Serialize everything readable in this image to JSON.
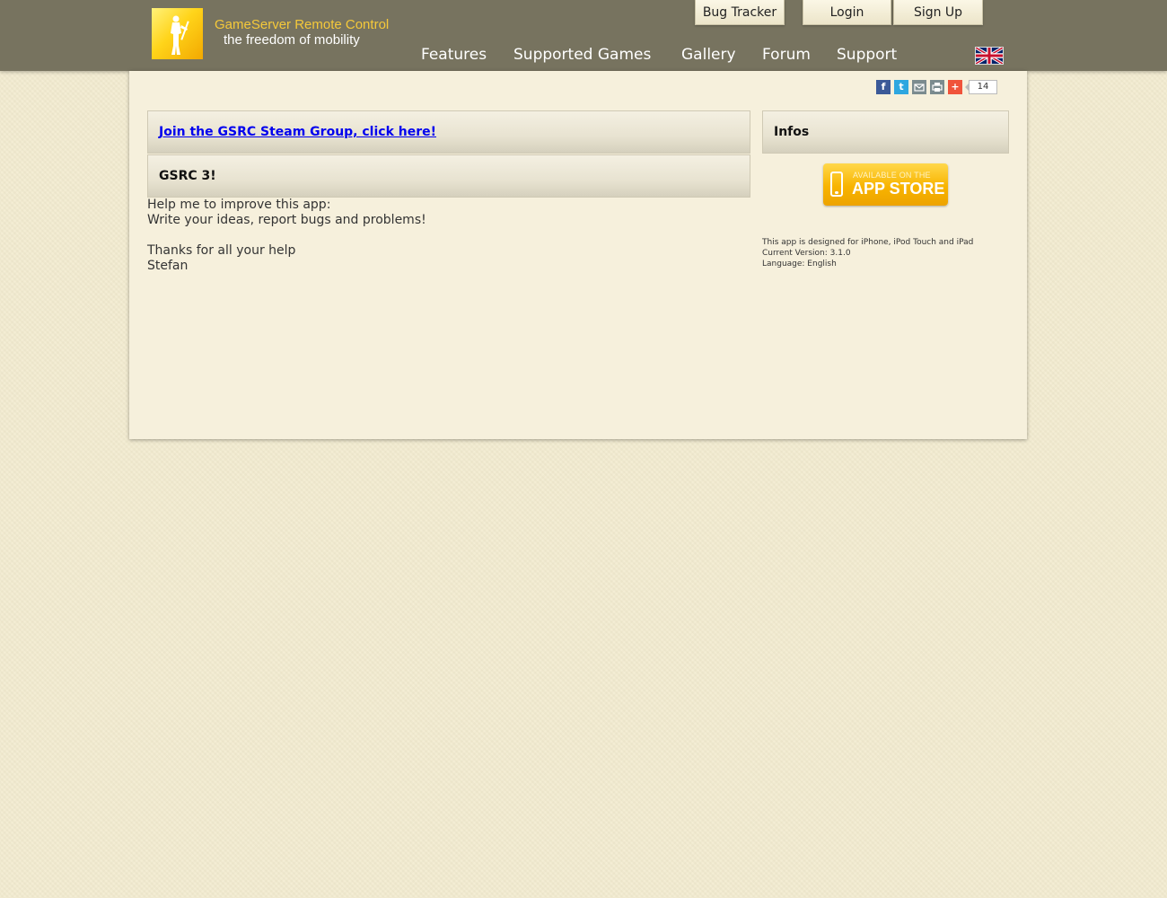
{
  "brand": {
    "title": "GameServer Remote Control",
    "subtitle": "the freedom of mobility",
    "logo_icon": "soldier-silhouette-icon"
  },
  "top_tabs": {
    "bug_tracker": "Bug Tracker",
    "login": "Login",
    "signup": "Sign Up"
  },
  "nav": {
    "features": "Features",
    "supported_games": "Supported Games",
    "gallery": "Gallery",
    "forum": "Forum",
    "support": "Support"
  },
  "language_flag": "uk-flag-icon",
  "share": {
    "icons": [
      "facebook-icon",
      "twitter-icon",
      "email-icon",
      "print-icon",
      "plus-icon"
    ],
    "count": "14"
  },
  "main": {
    "steam_link": "Join the GSRC Steam Group, click here!",
    "section_title": "GSRC 3!",
    "body_lines": [
      "Help me to improve this app:",
      "Write your ideas, report bugs and problems!",
      "",
      "Thanks for all your help",
      "Stefan"
    ]
  },
  "sidebar": {
    "title": "Infos",
    "appstore_small": "AVAILABLE ON THE",
    "appstore_big": "APP STORE",
    "info_lines": [
      "This app is designed for iPhone, iPod Touch and iPad",
      "Current Version: 3.1.0",
      "Language: English"
    ]
  },
  "colors": {
    "header_bg": "#77735f",
    "page_bg": "#f2ebcf",
    "content_bg": "#f6f0dc",
    "brand_title": "#f5c93a",
    "link": "#0000ee",
    "appstore": "#f8b400"
  }
}
